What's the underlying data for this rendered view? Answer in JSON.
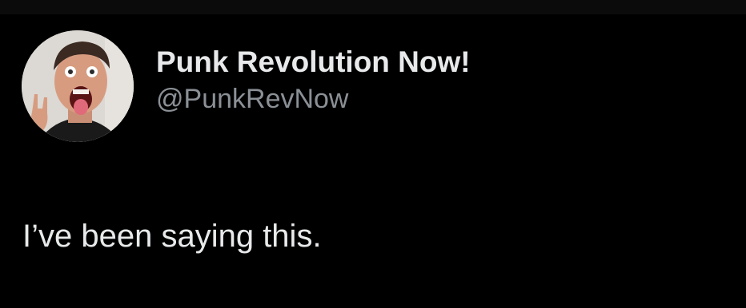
{
  "tweet": {
    "author": {
      "display_name": "Punk Revolution Now!",
      "handle": "@PunkRevNow",
      "avatar": "profile-photo"
    },
    "text": "I’ve been saying this."
  },
  "colors": {
    "background": "#000000",
    "primary_text": "#e7e9ea",
    "secondary_text": "#8b9096"
  }
}
